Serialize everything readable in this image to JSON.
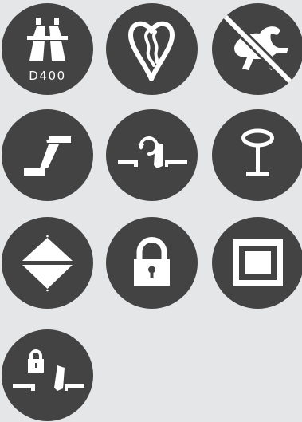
{
  "theme": {
    "page_background": "#e5e6e8",
    "tile_color": "#434343",
    "glyph_color": "#ffffff"
  },
  "icons": [
    {
      "name": "motorway-icon",
      "label": "D400"
    },
    {
      "name": "heart-road-icon"
    },
    {
      "name": "no-creature-icon"
    },
    {
      "name": "ramp-icon"
    },
    {
      "name": "drawbridge-open-icon"
    },
    {
      "name": "sign-post-icon"
    },
    {
      "name": "diamond-icon"
    },
    {
      "name": "lock-icon"
    },
    {
      "name": "square-frame-icon"
    },
    {
      "name": "locked-drawbridge-icon"
    }
  ]
}
